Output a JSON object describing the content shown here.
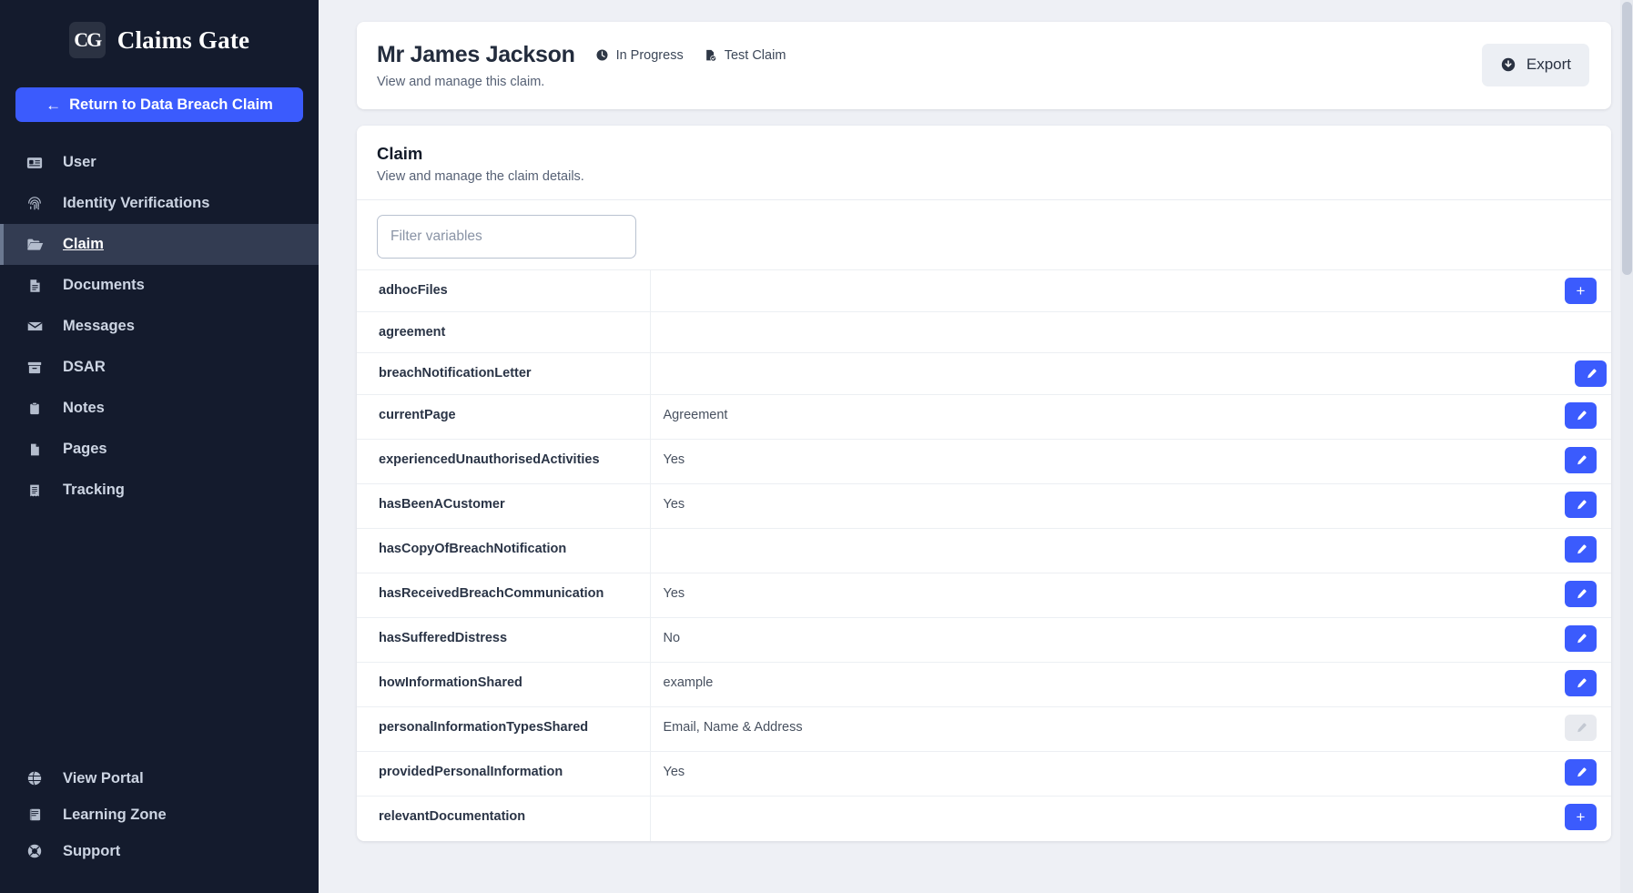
{
  "sidebar": {
    "brand": {
      "logo_text": "CG",
      "name": "Claims Gate"
    },
    "return_button": {
      "label": "Return to Data Breach Claim",
      "arrow": "←"
    },
    "items": [
      {
        "label": "User",
        "icon": "id-card-icon",
        "active": false
      },
      {
        "label": "Identity Verifications",
        "icon": "fingerprint-icon",
        "active": false
      },
      {
        "label": "Claim",
        "icon": "folder-open-icon",
        "active": true
      },
      {
        "label": "Documents",
        "icon": "document-icon",
        "active": false
      },
      {
        "label": "Messages",
        "icon": "envelope-icon",
        "active": false
      },
      {
        "label": "DSAR",
        "icon": "archive-icon",
        "active": false
      },
      {
        "label": "Notes",
        "icon": "clipboard-icon",
        "active": false
      },
      {
        "label": "Pages",
        "icon": "page-icon",
        "active": false
      },
      {
        "label": "Tracking",
        "icon": "receipt-icon",
        "active": false
      }
    ],
    "bottom_items": [
      {
        "label": "View Portal",
        "icon": "globe-icon"
      },
      {
        "label": "Learning Zone",
        "icon": "book-icon"
      },
      {
        "label": "Support",
        "icon": "lifebuoy-icon"
      }
    ]
  },
  "header": {
    "title": "Mr James Jackson",
    "subtitle": "View and manage this claim.",
    "badges": [
      {
        "label": "In Progress",
        "icon": "clock-icon"
      },
      {
        "label": "Test Claim",
        "icon": "file-check-icon"
      }
    ],
    "export_button": {
      "label": "Export",
      "icon": "download-circle-icon"
    }
  },
  "claim_card": {
    "title": "Claim",
    "subtitle": "View and manage the claim details.",
    "filter": {
      "placeholder": "Filter variables",
      "value": ""
    },
    "rows": [
      {
        "name": "adhocFiles",
        "value": "",
        "action": "add",
        "size": "sm",
        "shift": false
      },
      {
        "name": "agreement",
        "value": "",
        "action": "none",
        "size": "sm",
        "shift": false
      },
      {
        "name": "breachNotificationLetter",
        "value": "",
        "action": "edit",
        "size": "sm",
        "shift": true
      },
      {
        "name": "currentPage",
        "value": "Agreement",
        "action": "edit",
        "size": "md",
        "shift": false
      },
      {
        "name": "experiencedUnauthorisedActivities",
        "value": "Yes",
        "action": "edit",
        "size": "md",
        "shift": false
      },
      {
        "name": "hasBeenACustomer",
        "value": "Yes",
        "action": "edit",
        "size": "md",
        "shift": false
      },
      {
        "name": "hasCopyOfBreachNotification",
        "value": "",
        "action": "edit",
        "size": "md",
        "shift": false
      },
      {
        "name": "hasReceivedBreachCommunication",
        "value": "Yes",
        "action": "edit",
        "size": "md",
        "shift": false
      },
      {
        "name": "hasSufferedDistress",
        "value": "No",
        "action": "edit",
        "size": "md",
        "shift": false
      },
      {
        "name": "howInformationShared",
        "value": "example",
        "action": "edit",
        "size": "md",
        "shift": false
      },
      {
        "name": "personalInformationTypesShared",
        "value": "Email, Name & Address",
        "action": "edit-disabled",
        "size": "md",
        "shift": false
      },
      {
        "name": "providedPersonalInformation",
        "value": "Yes",
        "action": "edit",
        "size": "md",
        "shift": false
      },
      {
        "name": "relevantDocumentation",
        "value": "",
        "action": "add",
        "size": "md",
        "shift": false
      }
    ]
  },
  "colors": {
    "sidebar_bg": "#141b2d",
    "sidebar_active": "#333c52",
    "accent": "#3b5bfd",
    "page_bg": "#eef0f5",
    "card_bg": "#ffffff"
  }
}
